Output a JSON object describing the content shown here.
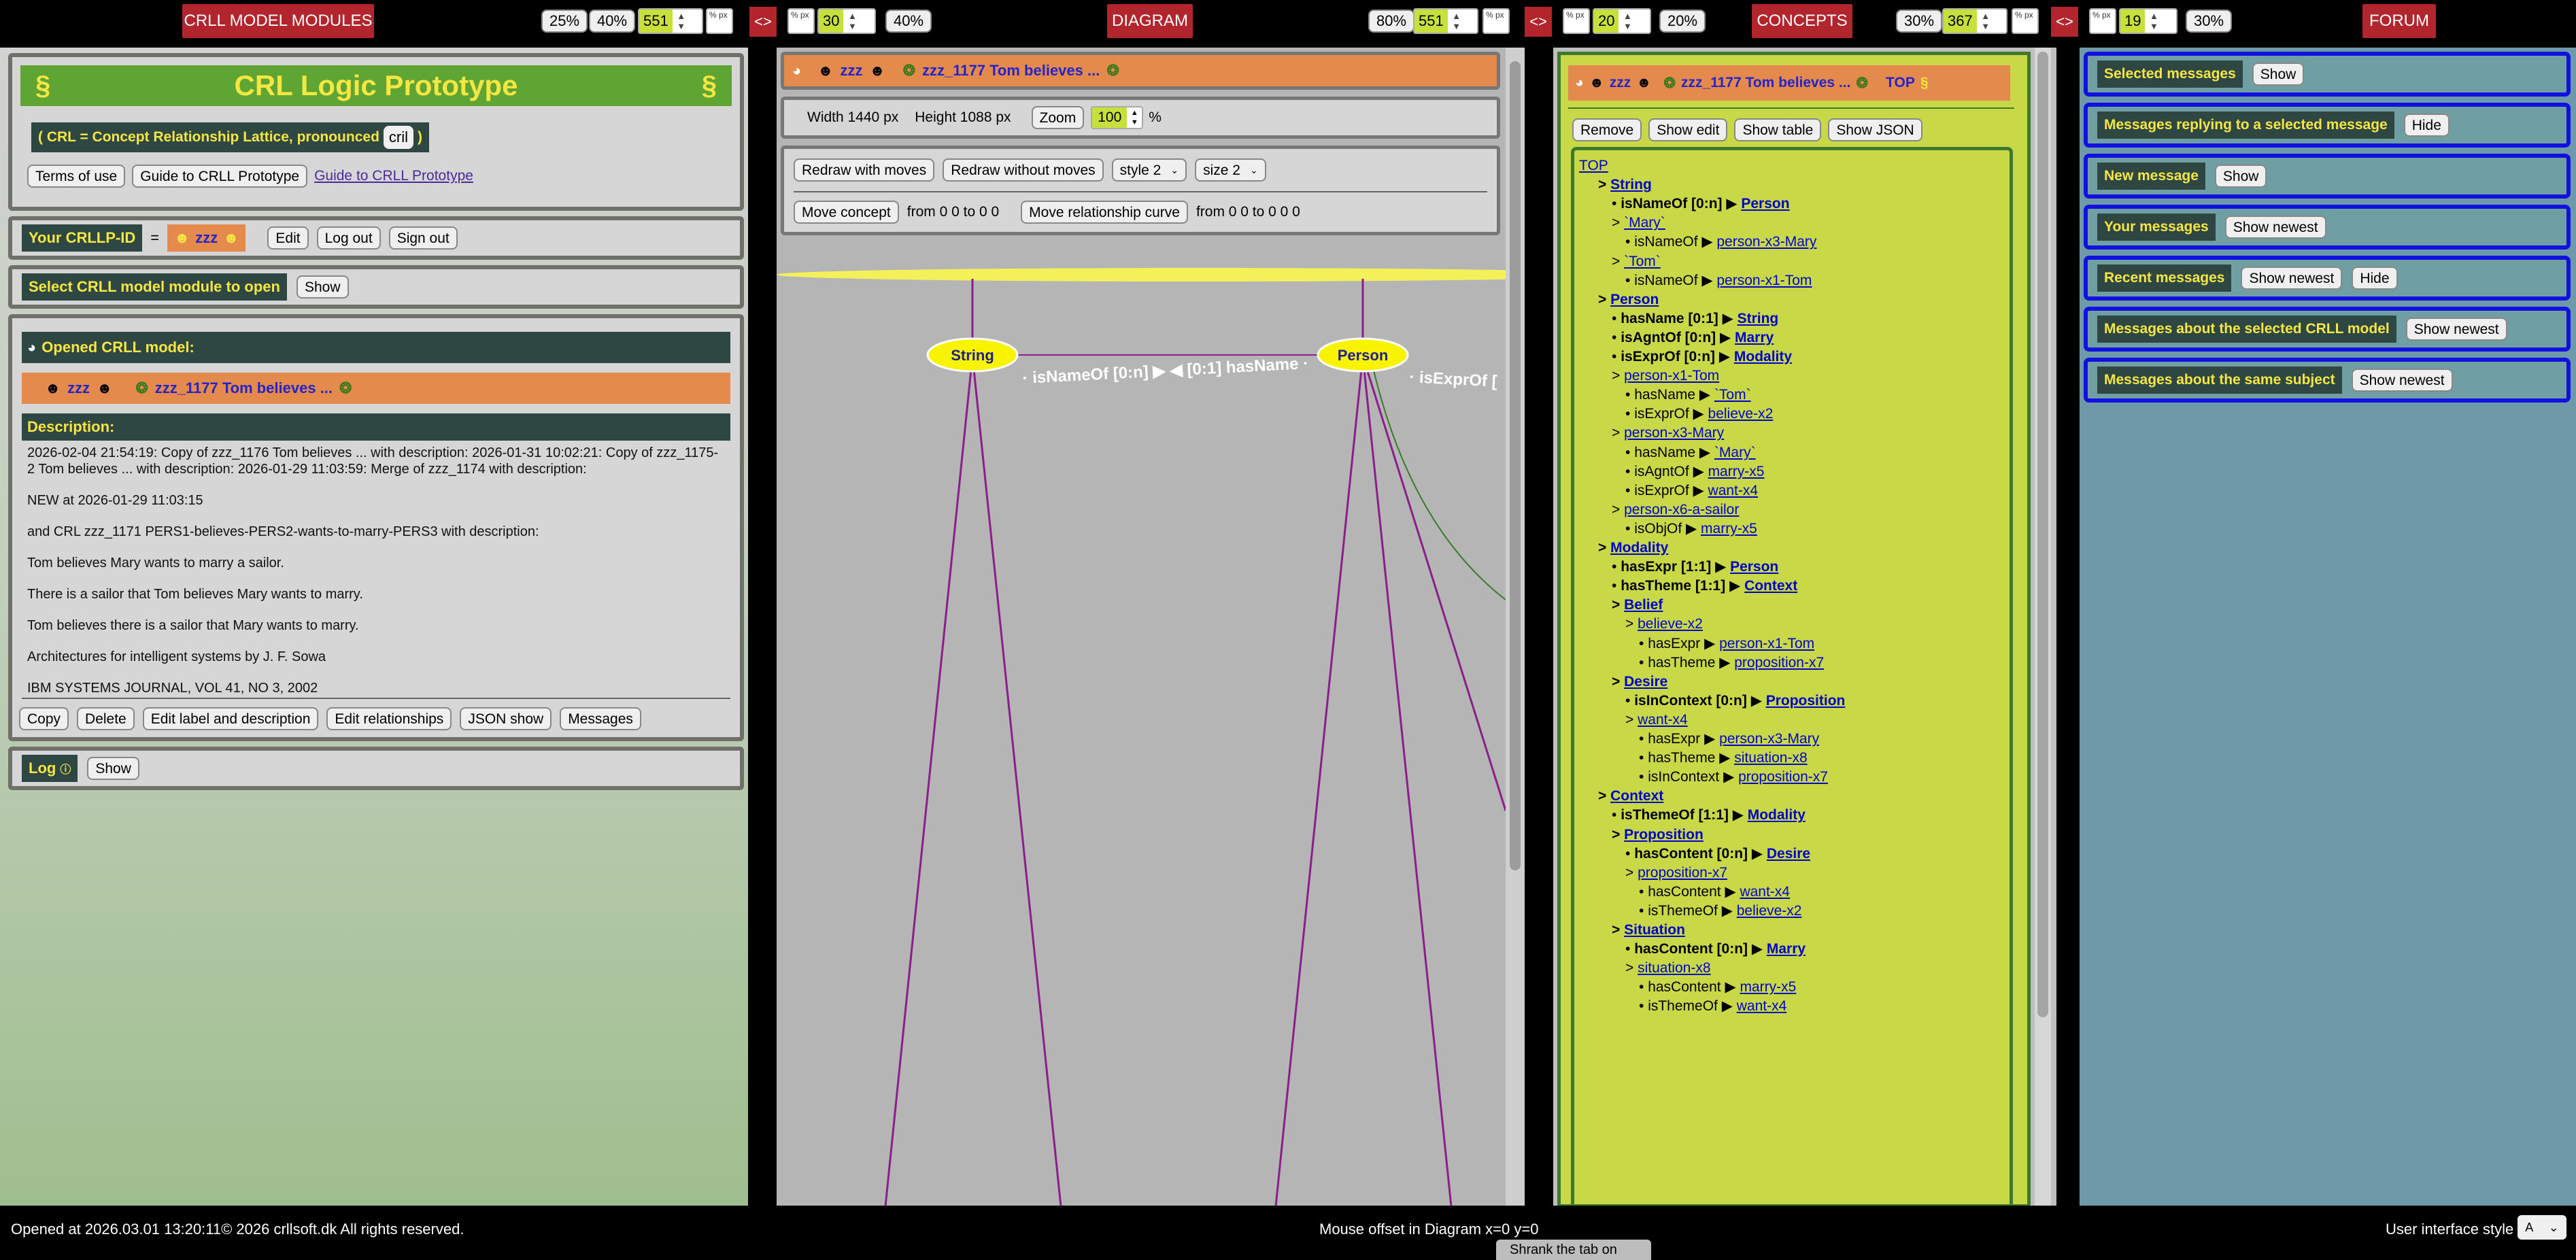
{
  "top_bar": {
    "modules_title": "CRLL MODEL MODULES",
    "modules_pcts": [
      "25%",
      "40%"
    ],
    "modules_px": "551",
    "modules_unit": "% px",
    "toggle": "<>",
    "diagram_unit_left": "% px",
    "diagram_px_left": "30",
    "diagram_pct_left": "40%",
    "diagram_title": "DIAGRAM",
    "diagram_pct_right": "80%",
    "diagram_px_right": "551",
    "diagram_unit_right": "% px",
    "concepts_unit_left": "% px",
    "concepts_px_left": "20",
    "concepts_pct_left": "20%",
    "concepts_title": "CONCEPTS",
    "concepts_pct_right": "30%",
    "concepts_px_right": "367",
    "concepts_unit_right": "% px",
    "forum_unit": "% px",
    "forum_px": "19",
    "forum_pct": "30%",
    "forum_title": "FORUM"
  },
  "left": {
    "title": "CRL Logic Prototype",
    "section_sign": "§",
    "subtitle": "( CRL = Concept Relationship Lattice, pronounced",
    "pronounced": "cril",
    "subtitle_end": ")",
    "terms_button": "Terms of use",
    "guide_button": "Guide to CRLL Prototype",
    "guide_link": "Guide to CRLL Prototype",
    "id_label": "Your CRLLP-ID",
    "equals": "=",
    "id_value": "zzz",
    "edit": "Edit",
    "logout": "Log out",
    "signout": "Sign out",
    "select_label": "Select CRLL model module to open",
    "show": "Show",
    "opened_label": "Opened CRLL model:",
    "opened_model_user": "zzz",
    "opened_model_name": "zzz_1177 Tom believes ...",
    "description_label": "Description:",
    "description": [
      "2026-02-04 21:54:19: Copy of zzz_1176 Tom believes ... with description: 2026-01-31 10:02:21: Copy of zzz_1175-2 Tom believes ... with description: 2026-01-29 11:03:59: Merge of zzz_1174 with description:",
      "NEW at 2026-01-29 11:03:15",
      "and CRL zzz_1171 PERS1-believes-PERS2-wants-to-marry-PERS3 with description:",
      "Tom believes Mary wants to marry a sailor.",
      "There is a sailor that Tom believes Mary wants to marry.",
      "Tom believes there is a sailor that Mary wants to marry.",
      "Architectures for intelligent systems by J. F. Sowa",
      "IBM SYSTEMS JOURNAL, VOL 41, NO 3, 2002"
    ],
    "actions": [
      "Copy",
      "Delete",
      "Edit label and description",
      "Edit relationships",
      "JSON show",
      "Messages"
    ],
    "log_label": "Log",
    "log_show": "Show"
  },
  "diagram": {
    "header_user": "zzz",
    "header_model": "zzz_1177 Tom believes ...",
    "width_label": "Width 1440 px",
    "height_label": "Height 1088 px",
    "zoom_button": "Zoom",
    "zoom_value": "100",
    "zoom_unit": "%",
    "redraw_moves": "Redraw with moves",
    "redraw_no_moves": "Redraw without moves",
    "style_select": "style 2",
    "size_select": "size 2",
    "move_concept": "Move concept",
    "move_concept_from": "from 0 0 to 0 0",
    "move_curve": "Move relationship curve",
    "move_curve_from": "from 0 0 to 0 0 0",
    "node_string": "String",
    "node_person": "Person",
    "edge_label_1": "· isNameOf [0:n] ▶ ◀ [0:1] hasName ·",
    "edge_label_2": "· isExprOf ["
  },
  "concepts": {
    "header_user": "zzz",
    "header_model": "zzz_1177 Tom believes ...",
    "header_top": "TOP",
    "header_section": "§",
    "remove": "Remove",
    "show_edit": "Show edit",
    "show_table": "Show table",
    "show_json": "Show JSON",
    "tree": [
      {
        "indent": 0,
        "kind": "link",
        "text": "TOP"
      },
      {
        "indent": 1,
        "kind": "concept",
        "text": "String"
      },
      {
        "indent": 2,
        "kind": "rel",
        "rel": "isNameOf [0:n]",
        "target": "Person"
      },
      {
        "indent": 2,
        "kind": "instance",
        "text": "`Mary`"
      },
      {
        "indent": 3,
        "kind": "irel",
        "rel": "isNameOf",
        "target": "person-x3-Mary"
      },
      {
        "indent": 2,
        "kind": "instance",
        "text": "`Tom`"
      },
      {
        "indent": 3,
        "kind": "irel",
        "rel": "isNameOf",
        "target": "person-x1-Tom"
      },
      {
        "indent": 1,
        "kind": "concept",
        "text": "Person"
      },
      {
        "indent": 2,
        "kind": "rel",
        "rel": "hasName [0:1]",
        "target": "String"
      },
      {
        "indent": 2,
        "kind": "rel",
        "rel": "isAgntOf [0:n]",
        "target": "Marry"
      },
      {
        "indent": 2,
        "kind": "rel",
        "rel": "isExprOf [0:n]",
        "target": "Modality"
      },
      {
        "indent": 2,
        "kind": "instance",
        "text": "person-x1-Tom"
      },
      {
        "indent": 3,
        "kind": "irel",
        "rel": "hasName",
        "target": "`Tom`"
      },
      {
        "indent": 3,
        "kind": "irel",
        "rel": "isExprOf",
        "target": "believe-x2"
      },
      {
        "indent": 2,
        "kind": "instance",
        "text": "person-x3-Mary"
      },
      {
        "indent": 3,
        "kind": "irel",
        "rel": "hasName",
        "target": "`Mary`"
      },
      {
        "indent": 3,
        "kind": "irel",
        "rel": "isAgntOf",
        "target": "marry-x5"
      },
      {
        "indent": 3,
        "kind": "irel",
        "rel": "isExprOf",
        "target": "want-x4"
      },
      {
        "indent": 2,
        "kind": "instance",
        "text": "person-x6-a-sailor"
      },
      {
        "indent": 3,
        "kind": "irel",
        "rel": "isObjOf",
        "target": "marry-x5"
      },
      {
        "indent": 1,
        "kind": "concept",
        "text": "Modality"
      },
      {
        "indent": 2,
        "kind": "rel",
        "rel": "hasExpr [1:1]",
        "target": "Person"
      },
      {
        "indent": 2,
        "kind": "rel",
        "rel": "hasTheme [1:1]",
        "target": "Context"
      },
      {
        "indent": 2,
        "kind": "concept",
        "text": "Belief"
      },
      {
        "indent": 3,
        "kind": "instance",
        "text": "believe-x2"
      },
      {
        "indent": 4,
        "kind": "irel",
        "rel": "hasExpr",
        "target": "person-x1-Tom"
      },
      {
        "indent": 4,
        "kind": "irel",
        "rel": "hasTheme",
        "target": "proposition-x7"
      },
      {
        "indent": 2,
        "kind": "concept",
        "text": "Desire"
      },
      {
        "indent": 3,
        "kind": "rel",
        "rel": "isInContext [0:n]",
        "target": "Proposition"
      },
      {
        "indent": 3,
        "kind": "instance",
        "text": "want-x4"
      },
      {
        "indent": 4,
        "kind": "irel",
        "rel": "hasExpr",
        "target": "person-x3-Mary"
      },
      {
        "indent": 4,
        "kind": "irel",
        "rel": "hasTheme",
        "target": "situation-x8"
      },
      {
        "indent": 4,
        "kind": "irel",
        "rel": "isInContext",
        "target": "proposition-x7"
      },
      {
        "indent": 1,
        "kind": "concept",
        "text": "Context"
      },
      {
        "indent": 2,
        "kind": "rel",
        "rel": "isThemeOf [1:1]",
        "target": "Modality"
      },
      {
        "indent": 2,
        "kind": "concept",
        "text": "Proposition"
      },
      {
        "indent": 3,
        "kind": "rel",
        "rel": "hasContent [0:n]",
        "target": "Desire"
      },
      {
        "indent": 3,
        "kind": "instance",
        "text": "proposition-x7"
      },
      {
        "indent": 4,
        "kind": "irel",
        "rel": "hasContent",
        "target": "want-x4"
      },
      {
        "indent": 4,
        "kind": "irel",
        "rel": "isThemeOf",
        "target": "believe-x2"
      },
      {
        "indent": 2,
        "kind": "concept",
        "text": "Situation"
      },
      {
        "indent": 3,
        "kind": "rel",
        "rel": "hasContent [0:n]",
        "target": "Marry"
      },
      {
        "indent": 3,
        "kind": "instance",
        "text": "situation-x8"
      },
      {
        "indent": 4,
        "kind": "irel",
        "rel": "hasContent",
        "target": "marry-x5"
      },
      {
        "indent": 4,
        "kind": "irel",
        "rel": "isThemeOf",
        "target": "want-x4"
      }
    ]
  },
  "forum": {
    "rows": [
      {
        "label": "Selected messages",
        "buttons": [
          "Show"
        ]
      },
      {
        "label": "Messages replying to a selected message",
        "buttons": [
          "Hide"
        ]
      },
      {
        "label": "New message",
        "buttons": [
          "Show"
        ]
      },
      {
        "label": "Your messages",
        "buttons": [
          "Show newest"
        ]
      },
      {
        "label": "Recent messages",
        "buttons": [
          "Show newest",
          "Hide"
        ]
      },
      {
        "label": "Messages about the selected CRLL model",
        "buttons": [
          "Show newest"
        ]
      },
      {
        "label": "Messages about the same subject",
        "buttons": [
          "Show newest"
        ]
      }
    ]
  },
  "footer": {
    "opened": "Opened at 2026.03.01 13:20:11© 2026 crllsoft.dk All rights reserved.",
    "mouse_offset": "Mouse offset in Diagram x=0 y=0",
    "ui_style_label": "User interface style",
    "ui_style_value": "A",
    "tooltip": "Shrank the tab on"
  },
  "colors": {
    "title_red": "#b3252c",
    "label_dark": "#2f4743",
    "label_yellow": "#f5e642",
    "concept_green": "#c9d847",
    "forum_teal": "#6f9ea3",
    "diagram_gray": "#b5b5b5",
    "edge_purple": "#8a1f8c"
  }
}
